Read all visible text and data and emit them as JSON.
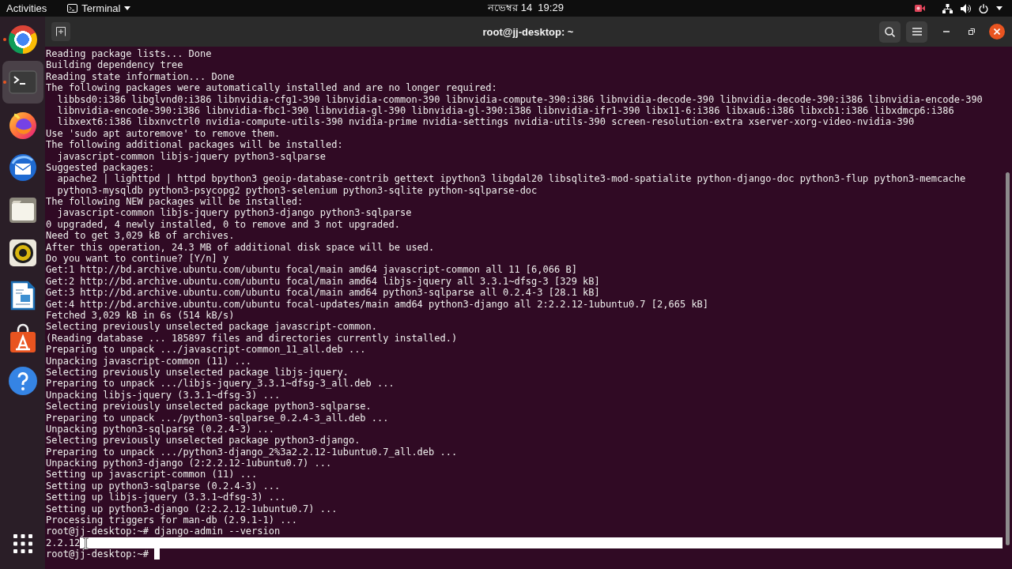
{
  "top_bar": {
    "activities": "Activities",
    "app_menu": {
      "label": "Terminal"
    },
    "clock": "নভেম্বর 14  19:29",
    "recording": true
  },
  "dock": {
    "items": [
      {
        "kind": "ring",
        "running": true,
        "selected": false
      },
      {
        "kind": "terminal",
        "running": true,
        "selected": true
      },
      {
        "kind": "flame",
        "running": false,
        "selected": false
      },
      {
        "kind": "envelope",
        "running": false,
        "selected": false
      },
      {
        "kind": "folder",
        "running": false,
        "selected": false
      },
      {
        "kind": "speaker",
        "running": false,
        "selected": false
      },
      {
        "kind": "document",
        "running": false,
        "selected": false
      },
      {
        "kind": "bag",
        "running": false,
        "selected": false
      },
      {
        "kind": "help",
        "running": false,
        "selected": false
      }
    ]
  },
  "window": {
    "title": "root@jj-desktop: ~"
  },
  "terminal": {
    "lines": [
      {
        "text": "Reading package lists... Done",
        "selected": false
      },
      {
        "text": "Building dependency tree",
        "selected": false
      },
      {
        "text": "Reading state information... Done",
        "selected": false
      },
      {
        "text": "The following packages were automatically installed and are no longer required:",
        "selected": false
      },
      {
        "text": "  libbsd0:i386 libglvnd0:i386 libnvidia-cfg1-390 libnvidia-common-390 libnvidia-compute-390:i386 libnvidia-decode-390 libnvidia-decode-390:i386 libnvidia-encode-390",
        "selected": false
      },
      {
        "text": "  libnvidia-encode-390:i386 libnvidia-fbc1-390 libnvidia-gl-390 libnvidia-gl-390:i386 libnvidia-ifr1-390 libx11-6:i386 libxau6:i386 libxcb1:i386 libxdmcp6:i386",
        "selected": false
      },
      {
        "text": "  libxext6:i386 libxnvctrl0 nvidia-compute-utils-390 nvidia-prime nvidia-settings nvidia-utils-390 screen-resolution-extra xserver-xorg-video-nvidia-390",
        "selected": false
      },
      {
        "text": "Use 'sudo apt autoremove' to remove them.",
        "selected": false
      },
      {
        "text": "The following additional packages will be installed:",
        "selected": false
      },
      {
        "text": "  javascript-common libjs-jquery python3-sqlparse",
        "selected": false
      },
      {
        "text": "Suggested packages:",
        "selected": false
      },
      {
        "text": "  apache2 | lighttpd | httpd bpython3 geoip-database-contrib gettext ipython3 libgdal20 libsqlite3-mod-spatialite python-django-doc python3-flup python3-memcache",
        "selected": false
      },
      {
        "text": "  python3-mysqldb python3-psycopg2 python3-selenium python3-sqlite python-sqlparse-doc",
        "selected": false
      },
      {
        "text": "The following NEW packages will be installed:",
        "selected": false
      },
      {
        "text": "  javascript-common libjs-jquery python3-django python3-sqlparse",
        "selected": false
      },
      {
        "text": "0 upgraded, 4 newly installed, 0 to remove and 3 not upgraded.",
        "selected": false
      },
      {
        "text": "Need to get 3,029 kB of archives.",
        "selected": false
      },
      {
        "text": "After this operation, 24.3 MB of additional disk space will be used.",
        "selected": false
      },
      {
        "text": "Do you want to continue? [Y/n] y",
        "selected": false
      },
      {
        "text": "Get:1 http://bd.archive.ubuntu.com/ubuntu focal/main amd64 javascript-common all 11 [6,066 B]",
        "selected": false
      },
      {
        "text": "Get:2 http://bd.archive.ubuntu.com/ubuntu focal/main amd64 libjs-jquery all 3.3.1~dfsg-3 [329 kB]",
        "selected": false
      },
      {
        "text": "Get:3 http://bd.archive.ubuntu.com/ubuntu focal/main amd64 python3-sqlparse all 0.2.4-3 [28.1 kB]",
        "selected": false
      },
      {
        "text": "Get:4 http://bd.archive.ubuntu.com/ubuntu focal-updates/main amd64 python3-django all 2:2.2.12-1ubuntu0.7 [2,665 kB]",
        "selected": false
      },
      {
        "text": "Fetched 3,029 kB in 6s (514 kB/s)",
        "selected": false
      },
      {
        "text": "Selecting previously unselected package javascript-common.",
        "selected": false
      },
      {
        "text": "(Reading database ... 185897 files and directories currently installed.)",
        "selected": false
      },
      {
        "text": "Preparing to unpack .../javascript-common_11_all.deb ...",
        "selected": false
      },
      {
        "text": "Unpacking javascript-common (11) ...",
        "selected": false
      },
      {
        "text": "Selecting previously unselected package libjs-jquery.",
        "selected": false
      },
      {
        "text": "Preparing to unpack .../libjs-jquery_3.3.1~dfsg-3_all.deb ...",
        "selected": false
      },
      {
        "text": "Unpacking libjs-jquery (3.3.1~dfsg-3) ...",
        "selected": false
      },
      {
        "text": "Selecting previously unselected package python3-sqlparse.",
        "selected": false
      },
      {
        "text": "Preparing to unpack .../python3-sqlparse_0.2.4-3_all.deb ...",
        "selected": false
      },
      {
        "text": "Unpacking python3-sqlparse (0.2.4-3) ...",
        "selected": false
      },
      {
        "text": "Selecting previously unselected package python3-django.",
        "selected": false
      },
      {
        "text": "Preparing to unpack .../python3-django_2%3a2.2.12-1ubuntu0.7_all.deb ...",
        "selected": false
      },
      {
        "text": "Unpacking python3-django (2:2.2.12-1ubuntu0.7) ...",
        "selected": false
      },
      {
        "text": "Setting up javascript-common (11) ...",
        "selected": false
      },
      {
        "text": "Setting up python3-sqlparse (0.2.4-3) ...",
        "selected": false
      },
      {
        "text": "Setting up libjs-jquery (3.3.1~dfsg-3) ...",
        "selected": false
      },
      {
        "text": "Setting up python3-django (2:2.2.12-1ubuntu0.7) ...",
        "selected": false
      },
      {
        "text": "Processing triggers for man-db (2.9.1-1) ...",
        "selected": false
      },
      {
        "text": "root@jj-desktop:~# django-admin --version",
        "selected": false
      },
      {
        "text": "2.2.12",
        "selected": true
      }
    ],
    "prompt": "root@jj-desktop:~#"
  }
}
